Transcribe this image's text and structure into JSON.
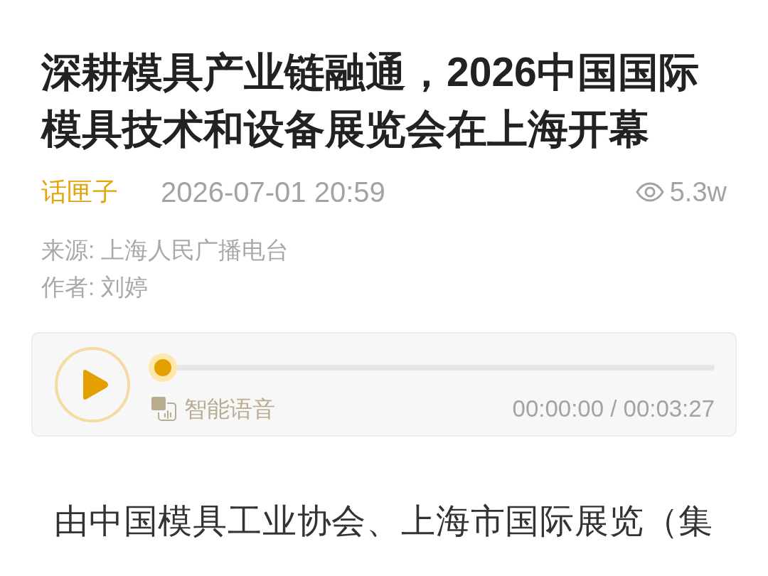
{
  "article": {
    "title": "深耕模具产业链融通，2026中国国际模具技术和设备展览会在上海开幕",
    "channel": "话匣子",
    "published": "2026-07-01 20:59",
    "views": "5.3w",
    "source": "来源: 上海人民广播电台",
    "author": "作者: 刘婷"
  },
  "audio_player": {
    "playing": false,
    "level": 0,
    "label": "智能语音",
    "time": "00:00:00 / 00:03:27"
  },
  "body": {
    "paragraphs": [
      "由中国模具工业协会、上海市国际展览（集"
    ]
  }
}
